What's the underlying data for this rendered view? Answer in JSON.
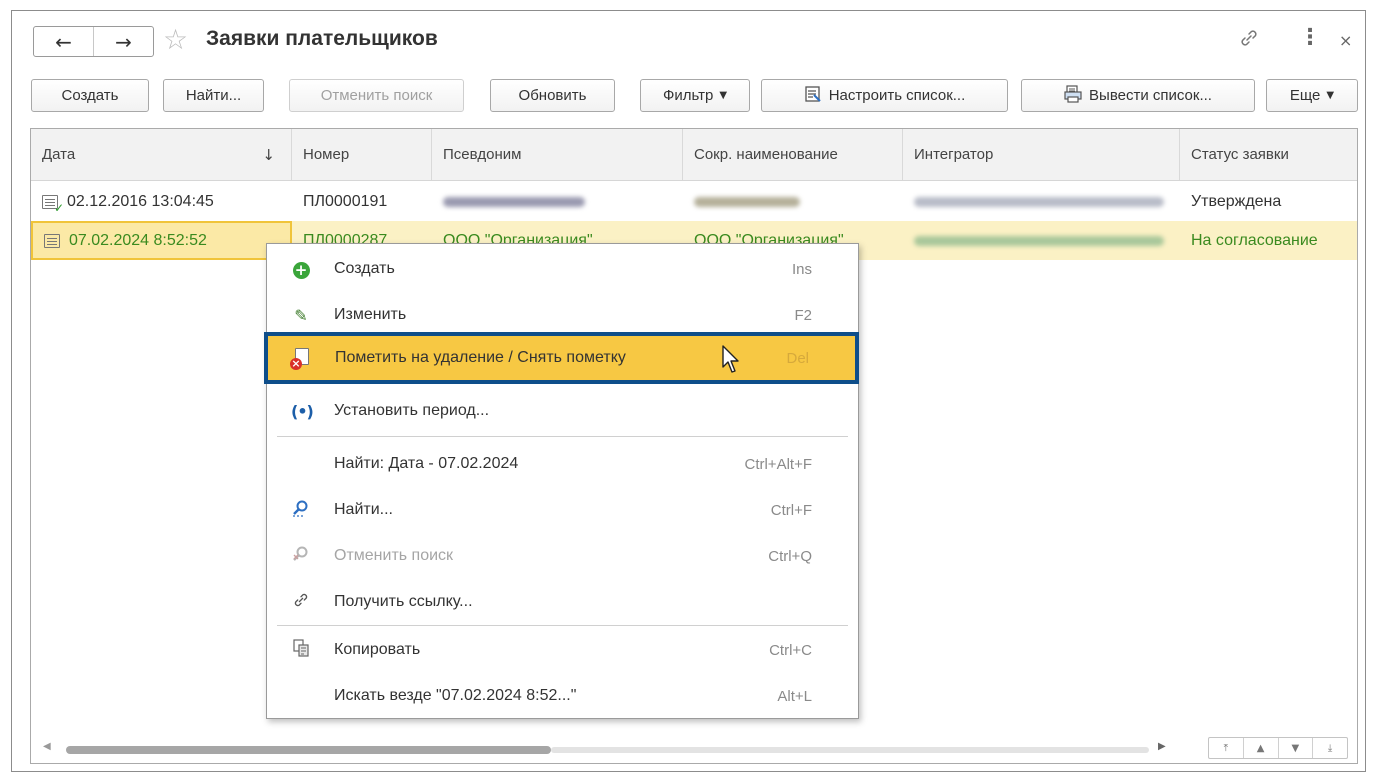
{
  "window": {
    "title": "Заявки плательщиков",
    "nav": {
      "back_icon": "←",
      "forward_icon": "→"
    },
    "favorite_icon": "☆",
    "link_icon": "🔗",
    "more_icon": "⋮",
    "close_icon": "×"
  },
  "toolbar": {
    "create": "Создать",
    "find": "Найти...",
    "cancel_search": "Отменить поиск",
    "refresh": "Обновить",
    "filter": "Фильтр",
    "customize_list": "Настроить список...",
    "output_list": "Вывести список...",
    "more": "Еще"
  },
  "table": {
    "columns": [
      "Дата",
      "Номер",
      "Псевдоним",
      "Сокр. наименование",
      "Интегратор",
      "Статус заявки"
    ],
    "sort_indicator": "↓",
    "rows": [
      {
        "date": "02.12.2016 13:04:45",
        "number": "ПЛ0000191",
        "alias": "",
        "short_name": "",
        "integrator": "",
        "status": "Утверждена"
      },
      {
        "date": "07.02.2024 8:52:52",
        "number": "ПЛ0000287",
        "alias": "ООО \"Организация\"",
        "short_name": "ООО \"Организация\"",
        "integrator": "",
        "status": "На согласование"
      }
    ]
  },
  "context_menu": {
    "items": [
      {
        "label": "Создать",
        "shortcut": "Ins",
        "icon": "plus-circle-icon"
      },
      {
        "label": "Изменить",
        "shortcut": "F2",
        "icon": "pencil-icon"
      },
      {
        "label": "Пометить на удаление / Снять пометку",
        "shortcut": "Del",
        "icon": "delete-mark-icon"
      },
      {
        "label": "Установить период...",
        "shortcut": "",
        "icon": "period-icon"
      },
      {
        "label": "Найти: Дата - 07.02.2024",
        "shortcut": "Ctrl+Alt+F",
        "icon": ""
      },
      {
        "label": "Найти...",
        "shortcut": "Ctrl+F",
        "icon": "find-icon"
      },
      {
        "label": "Отменить поиск",
        "shortcut": "Ctrl+Q",
        "icon": "cancel-search-icon"
      },
      {
        "label": "Получить ссылку...",
        "shortcut": "",
        "icon": "link-icon"
      },
      {
        "label": "Копировать",
        "shortcut": "Ctrl+C",
        "icon": "copy-icon"
      },
      {
        "label": "Искать везде \"07.02.2024 8:52...\"",
        "shortcut": "Alt+L",
        "icon": ""
      }
    ],
    "highlighted_index": 2
  },
  "colors": {
    "selected_row_bg": "#fbf1c5",
    "selected_text": "#3a8a1f",
    "menu_highlight": "#f7c843",
    "menu_highlight_border": "#0e4e8a"
  }
}
